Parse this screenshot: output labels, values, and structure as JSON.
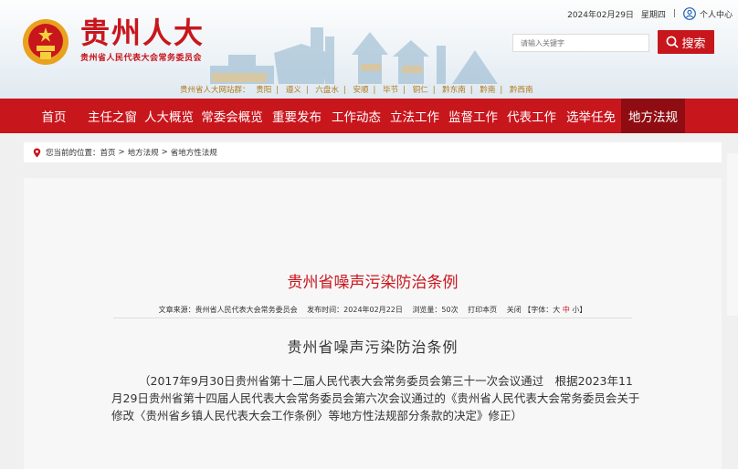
{
  "header": {
    "site_title": "贵州人大",
    "site_subtitle": "贵州省人民代表大会常务委员会",
    "date": "2024年02月29日",
    "weekday": "星期四",
    "user_center": "个人中心",
    "search_placeholder": "请输入关键字",
    "search_label": "搜索",
    "stations_label": "贵州省人大网站群：",
    "stations": [
      "贵阳",
      "遵义",
      "六盘水",
      "安顺",
      "毕节",
      "铜仁",
      "黔东南",
      "黔南",
      "黔西南"
    ]
  },
  "nav": {
    "items": [
      "首页",
      "主任之窗",
      "人大概览",
      "常委会概览",
      "重要发布",
      "工作动态",
      "立法工作",
      "监督工作",
      "代表工作",
      "选举任免",
      "地方法规"
    ],
    "active": "地方法规"
  },
  "breadcrumb": {
    "prefix": "您当前的位置：",
    "items": [
      "首页",
      "地方法规",
      "省地方性法规"
    ]
  },
  "article": {
    "title": "贵州省噪声污染防治条例",
    "meta_source": "文章来源：贵州省人民代表大会常务委员会",
    "meta_time": "发布时间：2024年02月22日",
    "meta_views": "浏览量：50次",
    "meta_print": "打印本页",
    "meta_close": "关闭",
    "font_prefix": "【字体：",
    "font_large": "大",
    "font_medium": "中",
    "font_small": "小",
    "font_suffix": "】",
    "doc_title": "贵州省噪声污染防治条例",
    "paragraph": "（2017年9月30日贵州省第十二届人民代表大会常务委员会第三十一次会议通过　根据2023年11月29日贵州省第十四届人民代表大会常务委员会第六次会议通过的《贵州省人民代表大会常务委员会关于修改〈贵州省乡镇人民代表大会工作条例〉等地方性法规部分条款的决定》修正）"
  },
  "colors": {
    "brand_red": "#c8161d",
    "nav_active": "#8f0d12",
    "station_gold": "#b07a1e"
  },
  "icons": [
    "emblem-icon",
    "user-icon",
    "search-icon",
    "location-pin-icon"
  ]
}
